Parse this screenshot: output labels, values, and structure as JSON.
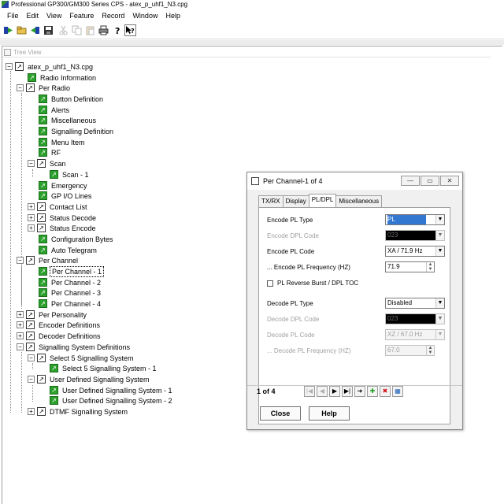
{
  "window": {
    "title": "Professional GP300/GM300 Series CPS - atex_p_uhf1_N3.cpg"
  },
  "menu": [
    "File",
    "Edit",
    "View",
    "Feature",
    "Record",
    "Window",
    "Help"
  ],
  "toolbar": {
    "icons": [
      "read-radio-icon",
      "open-icon",
      "write-radio-icon",
      "save-icon",
      "cut-icon",
      "copy-icon",
      "paste-icon",
      "print-icon",
      "help-icon",
      "context-help-icon"
    ]
  },
  "tree_view": {
    "caption": "Tree View",
    "nodes": [
      "atex_p_uhf1_N3.cpg",
      "Radio Information",
      "Per Radio",
      "Button Definition",
      "Alerts",
      "Miscellaneous",
      "Signalling Definition",
      "Menu Item",
      "RF",
      "Scan",
      "Scan - 1",
      "Emergency",
      "GP I/O Lines",
      "Contact List",
      "Status Decode",
      "Status Encode",
      "Configuration Bytes",
      "Auto Telegram",
      "Per Channel",
      "Per Channel - 1",
      "Per Channel - 2",
      "Per Channel - 3",
      "Per Channel - 4",
      "Per Personality",
      "Encoder Definitions",
      "Decoder Definitions",
      "Signalling System Definitions",
      "Select 5 Signalling System",
      "Select 5 Signalling System - 1",
      "User Defined Signalling System",
      "User Defined Signalling System - 1",
      "User Defined Signalling System - 2",
      "DTMF Signalling System"
    ]
  },
  "dialog": {
    "title": "Per Channel-1 of 4",
    "tabs": [
      "TX/RX",
      "Display",
      "PL/DPL",
      "Miscellaneous"
    ],
    "fields": {
      "encode_pl_type": {
        "label": "Encode PL Type",
        "value": "PL"
      },
      "encode_dpl_code": {
        "label": "Encode DPL Code",
        "value": "023"
      },
      "encode_pl_code": {
        "label": "Encode PL Code",
        "value": "XA / 71.9 Hz"
      },
      "encode_pl_freq": {
        "label": "... Encode PL Frequency (HZ)",
        "value": "71.9"
      },
      "pl_reverse_burst": {
        "label": "PL Reverse Burst / DPL TOC"
      },
      "decode_pl_type": {
        "label": "Decode PL Type",
        "value": "Disabled"
      },
      "decode_dpl_code": {
        "label": "Decode DPL Code",
        "value": "023"
      },
      "decode_pl_code": {
        "label": "Decode PL Code",
        "value": "XZ / 67.0 Hz"
      },
      "decode_pl_freq": {
        "label": "... Decode PL Frequency (HZ)",
        "value": "67.0"
      }
    },
    "record_position": "1 of 4",
    "close_label": "Close",
    "help_label": "Help"
  }
}
